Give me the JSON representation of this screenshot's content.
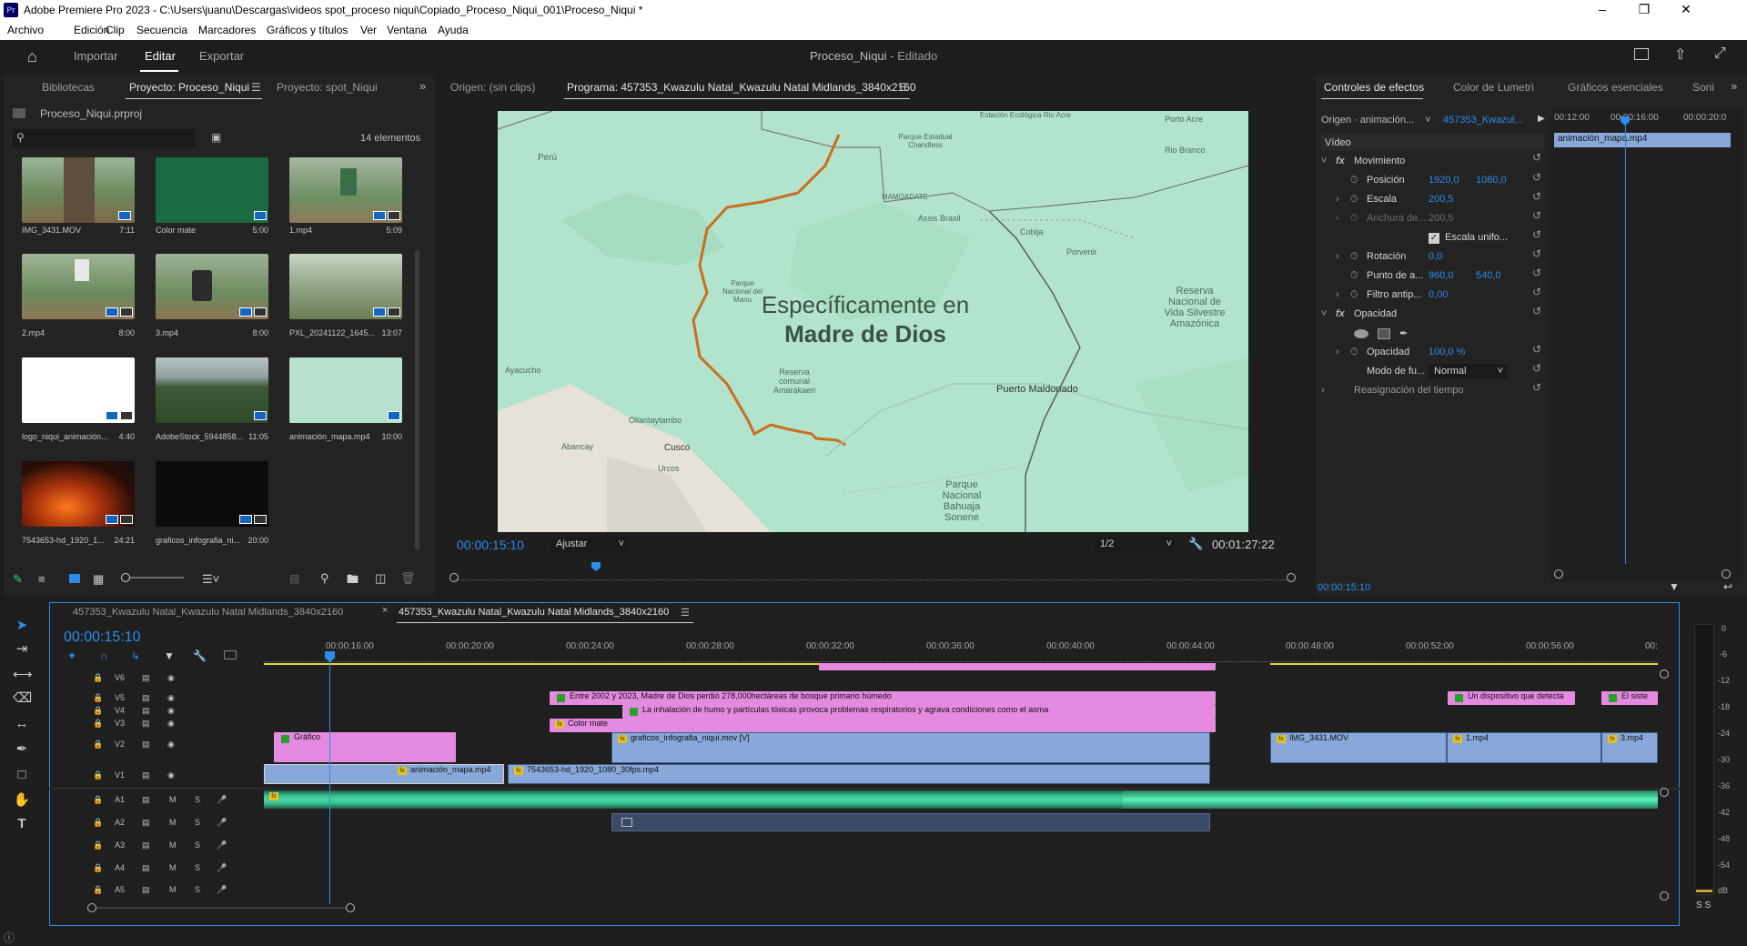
{
  "window": {
    "title": "Adobe Premiere Pro 2023 - C:\\Users\\juanu\\Descargas\\videos spot_proceso niqui\\Copiado_Proceso_Niqui_001\\Proceso_Niqui *",
    "app_icon": "Pr"
  },
  "menu": [
    "Archivo",
    "Edición",
    "Clip",
    "Secuencia",
    "Marcadores",
    "Gráficos y títulos",
    "Ver",
    "Ventana",
    "Ayuda"
  ],
  "header": {
    "tabs": [
      "Importar",
      "Editar",
      "Exportar"
    ],
    "active_tab": "Editar",
    "project_name": "Proceso_Niqui",
    "project_status": "- Editado"
  },
  "project_panel": {
    "tabs": [
      "Bibliotecas",
      "Proyecto: Proceso_Niqui",
      "Proyecto: spot_Niqui"
    ],
    "project_file": "Proceso_Niqui.prproj",
    "item_count": "14 elementos",
    "items": [
      {
        "name": "IMG_3431.MOV",
        "duration": "7:11"
      },
      {
        "name": "Color mate",
        "duration": "5:00"
      },
      {
        "name": "1.mp4",
        "duration": "5:09"
      },
      {
        "name": "2.mp4",
        "duration": "8:00"
      },
      {
        "name": "3.mp4",
        "duration": "8:00"
      },
      {
        "name": "PXL_20241122_1645...",
        "duration": "13:07"
      },
      {
        "name": "logo_niqui_animación...",
        "duration": "4:40"
      },
      {
        "name": "AdobeStock_5944858...",
        "duration": "11:05"
      },
      {
        "name": "animación_mapa.mp4",
        "duration": "10:00"
      },
      {
        "name": "7543653-hd_1920_1...",
        "duration": "24:21"
      },
      {
        "name": "graficos_infografia_ni...",
        "duration": "20:00"
      }
    ]
  },
  "monitor": {
    "source_tab": "Origen: (sin clips)",
    "program_tab": "Programa: 457353_Kwazulu Natal_Kwazulu Natal Midlands_3840x2160",
    "overlay_line1": "Específicamente en",
    "overlay_line2": "Madre de Dios",
    "timecode": "00:00:15:10",
    "fit": "Ajustar",
    "resolution": "1/2",
    "duration": "00:01:27:22",
    "map_labels": {
      "peru": "Perú",
      "porto_acre": "Porto Acre",
      "rio_branco": "Rio Branco",
      "cobija": "Cobija",
      "porvenir": "Porvenir",
      "assis": "Assis Brasil",
      "puerto_maldonado": "Puerto Maldonado",
      "cusco": "Cusco",
      "urcos": "Urcos",
      "ollantaytambo": "Ollantaytambo",
      "abancay": "Abancay",
      "reserva_tambopata": "Reserva Nacional de Vida Silvestre Amazónica",
      "bahuaja": "Parque Nacional Bahuaja Sonene",
      "manu": "Parque Nacional del Manu",
      "amarakaeri": "Reserva comunal Amarakaeri",
      "mamoadate": "MAMOADATE",
      "estacion": "Estación Ecológica Rio Acre",
      "chandless": "Parque Estadual Chandless",
      "ayacucho": "Ayacucho"
    }
  },
  "effect_controls": {
    "tabs": [
      "Controles de efectos",
      "Color de Lumetri",
      "Gráficos esenciales",
      "Soni"
    ],
    "source_label": "Origen · animación...",
    "sequence_label": "457353_Kwazul...",
    "section_video": "Vídeo",
    "motion": "Movimiento",
    "position_label": "Posición",
    "position_x": "1920,0",
    "position_y": "1080,0",
    "scale_label": "Escala",
    "scale": "200,5",
    "scale_width_label": "Anchura de...",
    "scale_width": "200,5",
    "uniform_scale": "Escala unifo...",
    "rotation_label": "Rotación",
    "rotation": "0,0",
    "anchor_label": "Punto de a...",
    "anchor_x": "960,0",
    "anchor_y": "540,0",
    "flicker_label": "Filtro antip...",
    "flicker": "0,00",
    "opacity_section": "Opacidad",
    "opacity_label": "Opacidad",
    "opacity": "100,0 %",
    "blend_label": "Modo de fu...",
    "blend": "Normal",
    "time_remap": "Reasignación del tiempo",
    "mini_timecodes": [
      "00:12:00",
      "00:00:16:00",
      "00:00:20:0"
    ],
    "mini_clip": "animación_mapa.mp4",
    "timecode": "00:00:15:10"
  },
  "timeline": {
    "tabs": [
      "457353_Kwazulu Natal_Kwazulu Natal Midlands_3840x2160",
      "457353_Kwazulu Natal_Kwazulu Natal Midlands_3840x2160"
    ],
    "timecode": "00:00:15:10",
    "ruler": [
      "00:00:16:00",
      "00:00:20:00",
      "00:00:24:00",
      "00:00:28:00",
      "00:00:32:00",
      "00:00:36:00",
      "00:00:40:00",
      "00:00:44:00",
      "00:00:48:00",
      "00:00:52:00",
      "00:00:56:00",
      "00:"
    ],
    "video_tracks": [
      "V6",
      "V5",
      "V4",
      "V3",
      "V2",
      "V1"
    ],
    "audio_tracks": [
      "A1",
      "A2",
      "A3",
      "A4",
      "A5"
    ],
    "clips": {
      "v5_a": "Entre 2002 y 2023, Madre de Dios perdió 278,000hectáreas de bosque primario húmedo",
      "v5_b": "Un dispositivo que detecta",
      "v5_c": "El siste",
      "v4_a": "La inhalación de humo y partículas tóxicas provoca problemas respiratorios y agrava condiciones como el asma",
      "v3_a": "Color mate",
      "v2_a": "Gráfico",
      "v2_b": "graficos_infografia_niqui.mov [V]",
      "v2_c": "IMG_3431.MOV",
      "v2_d": "1.mp4",
      "v2_e": "3.mp4",
      "v1_a": "animación_mapa.mp4",
      "v1_b": "7543653-hd_1920_1080_30fps.mp4"
    },
    "meter_scale": [
      "0",
      "-6",
      "-12",
      "-18",
      "-24",
      "-30",
      "-36",
      "-42",
      "-48",
      "-54",
      "dB"
    ],
    "meter_solo": "S S"
  }
}
